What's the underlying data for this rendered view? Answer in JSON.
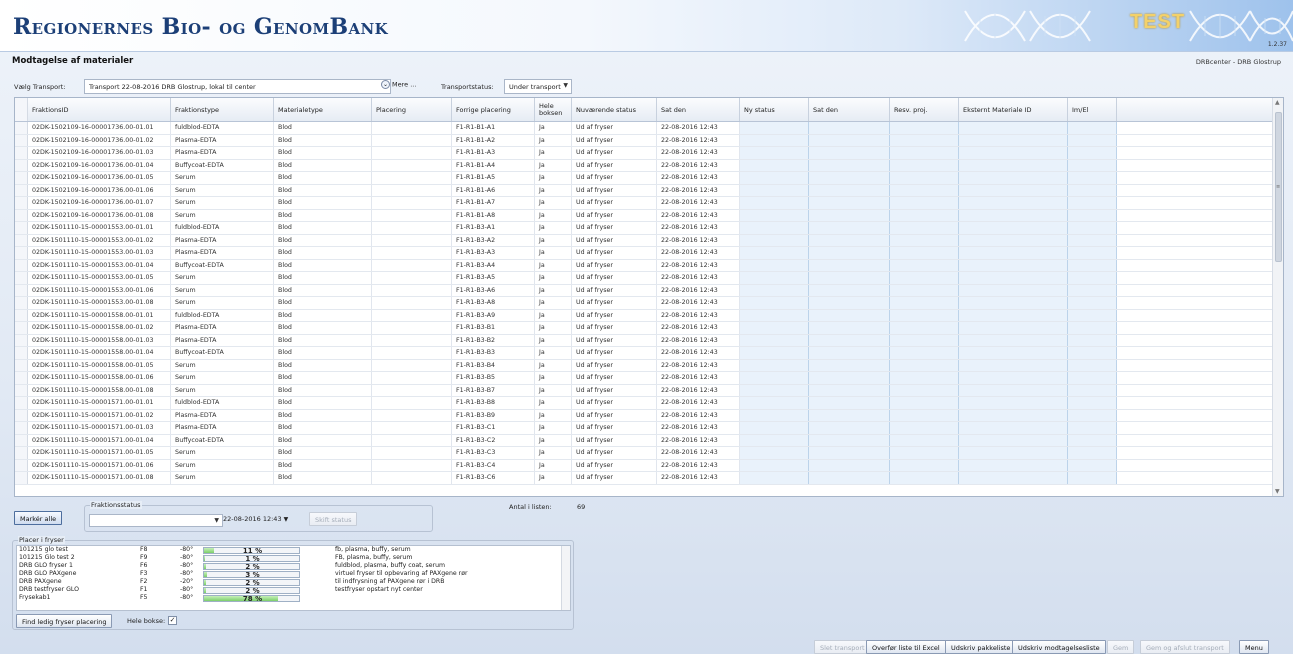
{
  "header": {
    "app_title": "Regionernes Bio- og GenomBank",
    "env_label": "TEST",
    "version": "1.2.37"
  },
  "page": {
    "title": "Modtagelse af materialer",
    "center": "DRBcenter - DRB Glostrup"
  },
  "transport": {
    "choose_label": "Vælg Transport:",
    "value": "Transport 22-08-2016 DRB Glostrup, lokal til center",
    "more_label": "Mere ...",
    "status_label": "Transportstatus:",
    "status_value": "Under transport"
  },
  "grid": {
    "columns": [
      "FraktionsID",
      "Fraktionstype",
      "Materialetype",
      "Placering",
      "Forrige placering",
      "Hele boksen",
      "Nuværende status",
      "Sat den",
      "Ny status",
      "Sat den",
      "Resv. proj.",
      "Eksternt Materiale ID",
      "Im/El"
    ],
    "rows": [
      [
        "02DK-1502109-16-00001736.00-01.01",
        "fuldblod-EDTA",
        "Blod",
        "",
        "F1-R1-B1-A1",
        "Ja",
        "Ud af fryser",
        "22-08-2016 12:43"
      ],
      [
        "02DK-1502109-16-00001736.00-01.02",
        "Plasma-EDTA",
        "Blod",
        "",
        "F1-R1-B1-A2",
        "Ja",
        "Ud af fryser",
        "22-08-2016 12:43"
      ],
      [
        "02DK-1502109-16-00001736.00-01.03",
        "Plasma-EDTA",
        "Blod",
        "",
        "F1-R1-B1-A3",
        "Ja",
        "Ud af fryser",
        "22-08-2016 12:43"
      ],
      [
        "02DK-1502109-16-00001736.00-01.04",
        "Buffycoat-EDTA",
        "Blod",
        "",
        "F1-R1-B1-A4",
        "Ja",
        "Ud af fryser",
        "22-08-2016 12:43"
      ],
      [
        "02DK-1502109-16-00001736.00-01.05",
        "Serum",
        "Blod",
        "",
        "F1-R1-B1-A5",
        "Ja",
        "Ud af fryser",
        "22-08-2016 12:43"
      ],
      [
        "02DK-1502109-16-00001736.00-01.06",
        "Serum",
        "Blod",
        "",
        "F1-R1-B1-A6",
        "Ja",
        "Ud af fryser",
        "22-08-2016 12:43"
      ],
      [
        "02DK-1502109-16-00001736.00-01.07",
        "Serum",
        "Blod",
        "",
        "F1-R1-B1-A7",
        "Ja",
        "Ud af fryser",
        "22-08-2016 12:43"
      ],
      [
        "02DK-1502109-16-00001736.00-01.08",
        "Serum",
        "Blod",
        "",
        "F1-R1-B1-A8",
        "Ja",
        "Ud af fryser",
        "22-08-2016 12:43"
      ],
      [
        "02DK-1501110-15-00001553.00-01.01",
        "fuldblod-EDTA",
        "Blod",
        "",
        "F1-R1-B3-A1",
        "Ja",
        "Ud af fryser",
        "22-08-2016 12:43"
      ],
      [
        "02DK-1501110-15-00001553.00-01.02",
        "Plasma-EDTA",
        "Blod",
        "",
        "F1-R1-B3-A2",
        "Ja",
        "Ud af fryser",
        "22-08-2016 12:43"
      ],
      [
        "02DK-1501110-15-00001553.00-01.03",
        "Plasma-EDTA",
        "Blod",
        "",
        "F1-R1-B3-A3",
        "Ja",
        "Ud af fryser",
        "22-08-2016 12:43"
      ],
      [
        "02DK-1501110-15-00001553.00-01.04",
        "Buffycoat-EDTA",
        "Blod",
        "",
        "F1-R1-B3-A4",
        "Ja",
        "Ud af fryser",
        "22-08-2016 12:43"
      ],
      [
        "02DK-1501110-15-00001553.00-01.05",
        "Serum",
        "Blod",
        "",
        "F1-R1-B3-A5",
        "Ja",
        "Ud af fryser",
        "22-08-2016 12:43"
      ],
      [
        "02DK-1501110-15-00001553.00-01.06",
        "Serum",
        "Blod",
        "",
        "F1-R1-B3-A6",
        "Ja",
        "Ud af fryser",
        "22-08-2016 12:43"
      ],
      [
        "02DK-1501110-15-00001553.00-01.08",
        "Serum",
        "Blod",
        "",
        "F1-R1-B3-A8",
        "Ja",
        "Ud af fryser",
        "22-08-2016 12:43"
      ],
      [
        "02DK-1501110-15-00001558.00-01.01",
        "fuldblod-EDTA",
        "Blod",
        "",
        "F1-R1-B3-A9",
        "Ja",
        "Ud af fryser",
        "22-08-2016 12:43"
      ],
      [
        "02DK-1501110-15-00001558.00-01.02",
        "Plasma-EDTA",
        "Blod",
        "",
        "F1-R1-B3-B1",
        "Ja",
        "Ud af fryser",
        "22-08-2016 12:43"
      ],
      [
        "02DK-1501110-15-00001558.00-01.03",
        "Plasma-EDTA",
        "Blod",
        "",
        "F1-R1-B3-B2",
        "Ja",
        "Ud af fryser",
        "22-08-2016 12:43"
      ],
      [
        "02DK-1501110-15-00001558.00-01.04",
        "Buffycoat-EDTA",
        "Blod",
        "",
        "F1-R1-B3-B3",
        "Ja",
        "Ud af fryser",
        "22-08-2016 12:43"
      ],
      [
        "02DK-1501110-15-00001558.00-01.05",
        "Serum",
        "Blod",
        "",
        "F1-R1-B3-B4",
        "Ja",
        "Ud af fryser",
        "22-08-2016 12:43"
      ],
      [
        "02DK-1501110-15-00001558.00-01.06",
        "Serum",
        "Blod",
        "",
        "F1-R1-B3-B5",
        "Ja",
        "Ud af fryser",
        "22-08-2016 12:43"
      ],
      [
        "02DK-1501110-15-00001558.00-01.08",
        "Serum",
        "Blod",
        "",
        "F1-R1-B3-B7",
        "Ja",
        "Ud af fryser",
        "22-08-2016 12:43"
      ],
      [
        "02DK-1501110-15-00001571.00-01.01",
        "fuldblod-EDTA",
        "Blod",
        "",
        "F1-R1-B3-B8",
        "Ja",
        "Ud af fryser",
        "22-08-2016 12:43"
      ],
      [
        "02DK-1501110-15-00001571.00-01.02",
        "Plasma-EDTA",
        "Blod",
        "",
        "F1-R1-B3-B9",
        "Ja",
        "Ud af fryser",
        "22-08-2016 12:43"
      ],
      [
        "02DK-1501110-15-00001571.00-01.03",
        "Plasma-EDTA",
        "Blod",
        "",
        "F1-R1-B3-C1",
        "Ja",
        "Ud af fryser",
        "22-08-2016 12:43"
      ],
      [
        "02DK-1501110-15-00001571.00-01.04",
        "Buffycoat-EDTA",
        "Blod",
        "",
        "F1-R1-B3-C2",
        "Ja",
        "Ud af fryser",
        "22-08-2016 12:43"
      ],
      [
        "02DK-1501110-15-00001571.00-01.05",
        "Serum",
        "Blod",
        "",
        "F1-R1-B3-C3",
        "Ja",
        "Ud af fryser",
        "22-08-2016 12:43"
      ],
      [
        "02DK-1501110-15-00001571.00-01.06",
        "Serum",
        "Blod",
        "",
        "F1-R1-B3-C4",
        "Ja",
        "Ud af fryser",
        "22-08-2016 12:43"
      ],
      [
        "02DK-1501110-15-00001571.00-01.08",
        "Serum",
        "Blod",
        "",
        "F1-R1-B3-C6",
        "Ja",
        "Ud af fryser",
        "22-08-2016 12:43"
      ]
    ]
  },
  "actions": {
    "mark_all": "Markér alle",
    "fraction_status_label": "Fraktionsstatus",
    "date_value": "22-08-2016 12:43",
    "change_status": "Skift status",
    "count_label": "Antal i listen:",
    "count_value": "69"
  },
  "freezers": {
    "legend": "Placer i fryser",
    "rows": [
      {
        "name": "101215 glo test",
        "code": "F8",
        "temp": "-80°",
        "pct": 11,
        "pct_label": "11 %",
        "desc": "fb, plasma, buffy, serum"
      },
      {
        "name": "101215 Glo test 2",
        "code": "F9",
        "temp": "-80°",
        "pct": 1,
        "pct_label": "1 %",
        "desc": "FB, plasma, buffy, serum"
      },
      {
        "name": "DRB GLO fryser 1",
        "code": "F6",
        "temp": "-80°",
        "pct": 2,
        "pct_label": "2 %",
        "desc": "fuldblod, plasma, buffy coat, serum"
      },
      {
        "name": "DRB GLO PAXgene",
        "code": "F3",
        "temp": "-80°",
        "pct": 3,
        "pct_label": "3 %",
        "desc": "virtuel fryser til opbevaring af PAXgene rør"
      },
      {
        "name": "DRB PAXgene",
        "code": "F2",
        "temp": "-20°",
        "pct": 2,
        "pct_label": "2 %",
        "desc": "til indfrysning af PAXgene rør i DRB"
      },
      {
        "name": "DRB testfryser GLO",
        "code": "F1",
        "temp": "-80°",
        "pct": 2,
        "pct_label": "2 %",
        "desc": "testfryser opstart nyt center"
      },
      {
        "name": "Frysekab1",
        "code": "F5",
        "temp": "-80°",
        "pct": 78,
        "pct_label": "78 %",
        "desc": ""
      }
    ],
    "find_button": "Find ledig fryser placering",
    "whole_box_label": "Hele bokse:",
    "whole_box_checked": "✓"
  },
  "footer": {
    "buttons": [
      "Slet transport",
      "Overfør liste til Excel",
      "Udskriv pakkeliste",
      "Udskriv modtagelsesliste",
      "Gem",
      "Gem og afslut transport",
      "Menu"
    ]
  }
}
